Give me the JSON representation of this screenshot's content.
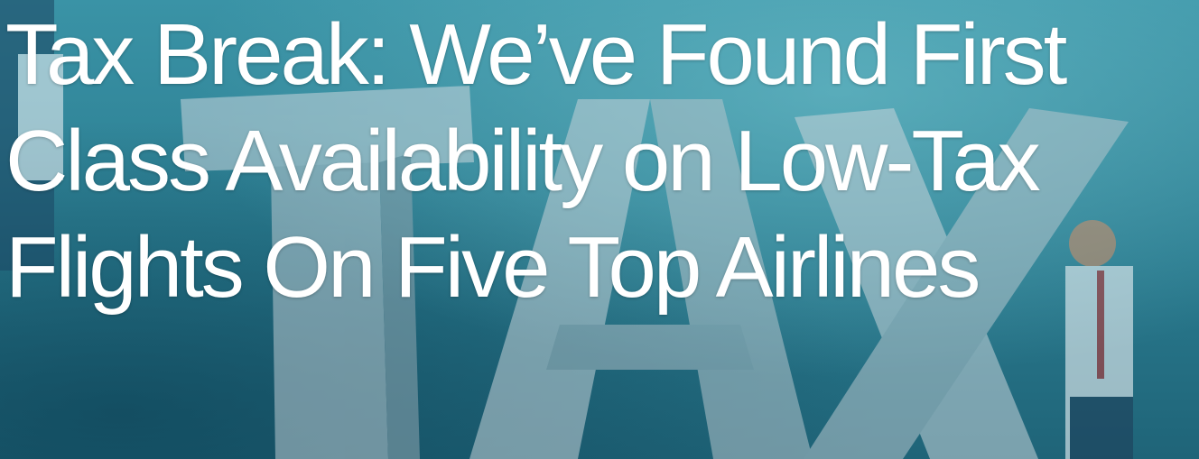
{
  "article": {
    "title": "Tax Break: We’ve Found First Class Availability on Low-Tax Flights On Five Top Airlines"
  },
  "image": {
    "word_art": "TAX",
    "accent_color": "#2a7b8f"
  }
}
